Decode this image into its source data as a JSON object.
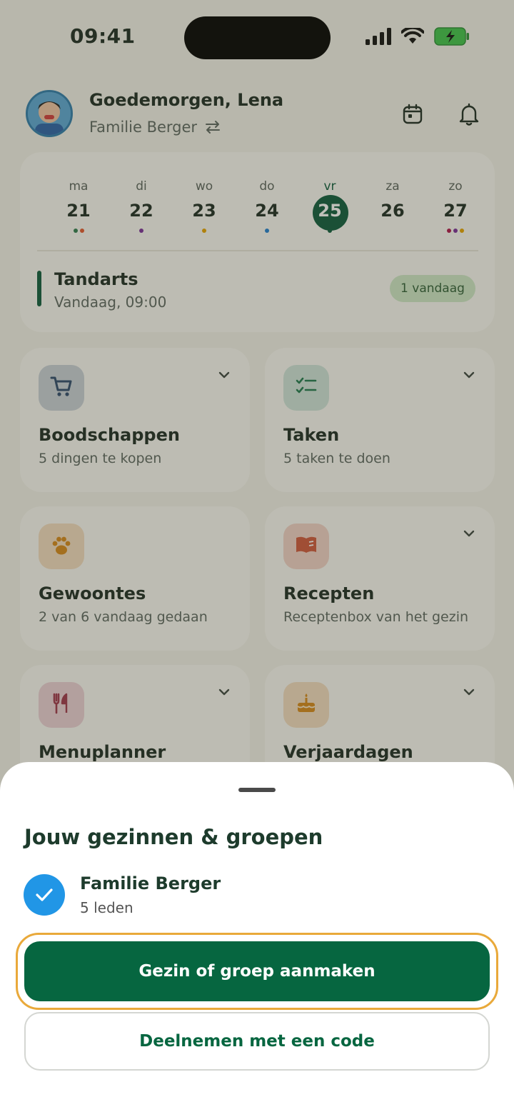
{
  "status_bar": {
    "time": "09:41"
  },
  "header": {
    "greeting": "Goedemorgen, Lena",
    "family": "Familie Berger"
  },
  "calendar": {
    "days": [
      {
        "name": "ma",
        "date": "21",
        "dots": [
          "#2e7d4f",
          "#e4572e"
        ]
      },
      {
        "name": "di",
        "date": "22",
        "dots": [
          "#7b2d9a"
        ]
      },
      {
        "name": "wo",
        "date": "23",
        "dots": [
          "#e6a200"
        ]
      },
      {
        "name": "do",
        "date": "24",
        "dots": [
          "#1f7fd1"
        ]
      },
      {
        "name": "vr",
        "date": "25",
        "dots": [
          "#0c5b3d"
        ],
        "selected": true
      },
      {
        "name": "za",
        "date": "26",
        "dots": []
      },
      {
        "name": "zo",
        "date": "27",
        "dots": [
          "#b0144a",
          "#7b2d9a",
          "#e6a200"
        ]
      }
    ],
    "event": {
      "title": "Tandarts",
      "time": "Vandaag, 09:00",
      "badge": "1 vandaag"
    }
  },
  "tiles": [
    {
      "title": "Boodschappen",
      "subtitle": "5 dingen te kopen",
      "icon": "cart-icon",
      "color": "#c9d0d8",
      "chevron": true
    },
    {
      "title": "Taken",
      "subtitle": "5 taken te doen",
      "icon": "checklist-icon",
      "color": "#cfe4da",
      "chevron": true
    },
    {
      "title": "Gewoontes",
      "subtitle": "2 van 6 vandaag gedaan",
      "icon": "paw-icon",
      "color": "#f3dcc0",
      "chevron": false
    },
    {
      "title": "Recepten",
      "subtitle": "Receptenbox van het gezin",
      "icon": "book-icon",
      "color": "#f2d2c8",
      "chevron": true
    },
    {
      "title": "Menuplanner",
      "subtitle": "",
      "icon": "cutlery-icon",
      "color": "#ecd0d6",
      "chevron": true
    },
    {
      "title": "Verjaardagen",
      "subtitle": "",
      "icon": "cake-icon",
      "color": "#f3dcc0",
      "chevron": true
    }
  ],
  "sheet": {
    "title": "Jouw gezinnen & groepen",
    "group": {
      "name": "Familie Berger",
      "count": "5 leden"
    },
    "primary_button": "Gezin of groep aanmaken",
    "secondary_button": "Deelnemen met een code"
  }
}
